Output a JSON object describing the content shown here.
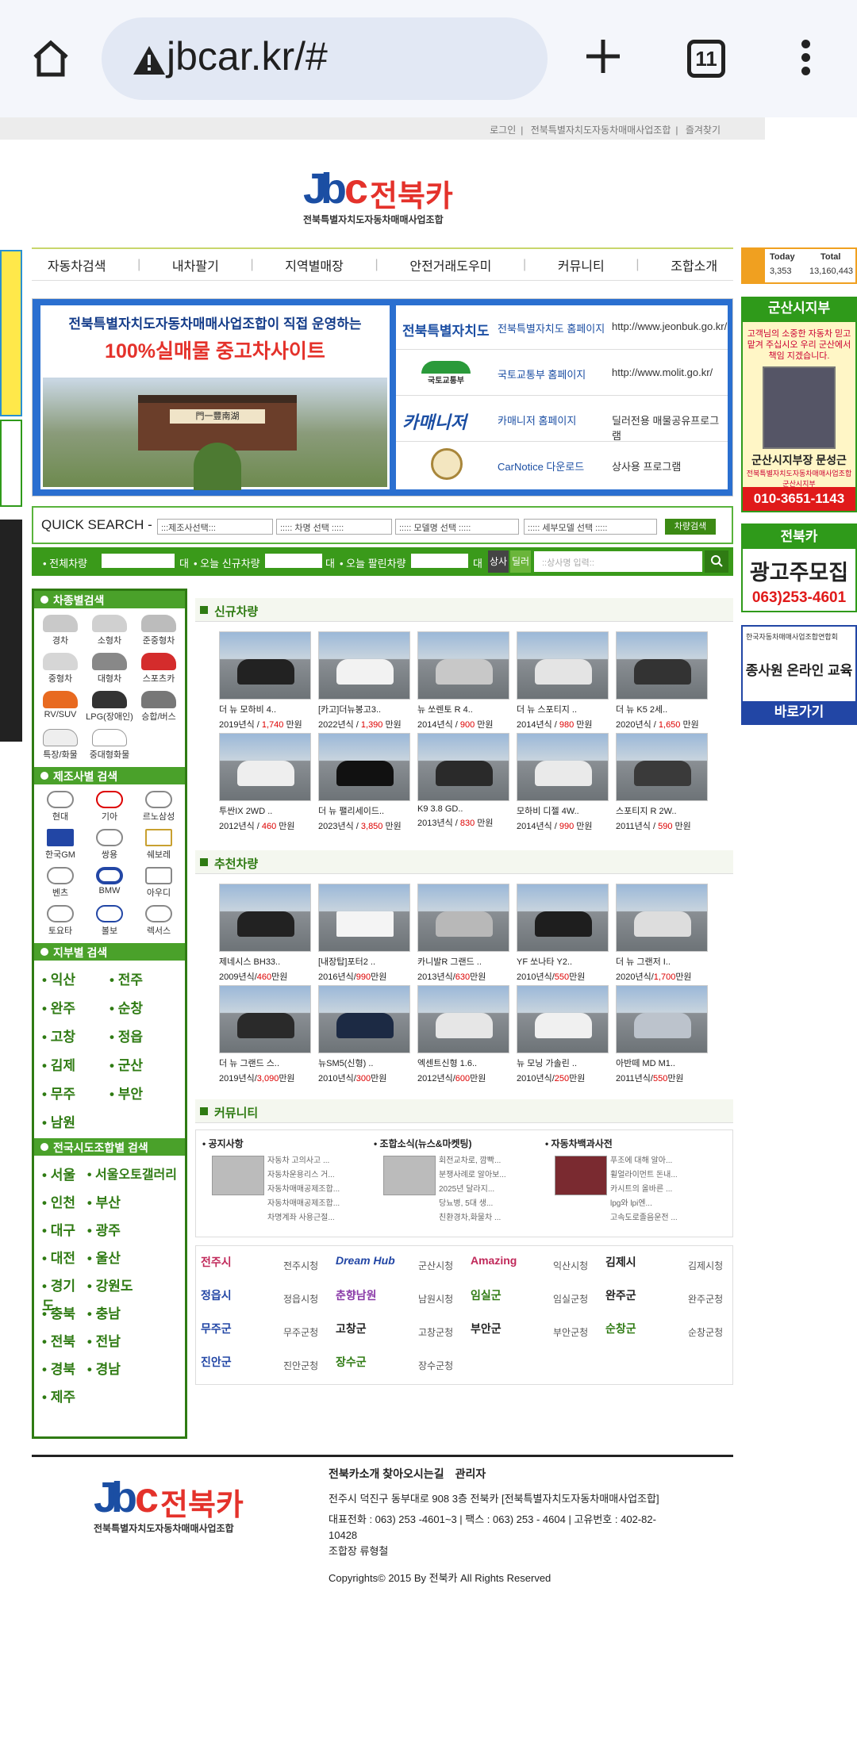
{
  "browser": {
    "url": "jbcar.kr/#",
    "tab_count": "11"
  },
  "topbar": {
    "links": [
      "로그인",
      "전북특별자치도자동차매매사업조합",
      "즐겨찾기"
    ]
  },
  "logo": {
    "brand": "전북카",
    "sub": "전북특별자치도자동차매매사업조합"
  },
  "nav": [
    "자동차검색",
    "내차팔기",
    "지역별매장",
    "안전거래도우미",
    "커뮤니티",
    "조합소개"
  ],
  "banner": {
    "line1": "전북특별자치도자동차매매사업조합이 직접 운영하는",
    "line2": "100%실매물 중고차사이트",
    "links": [
      {
        "logo": "전북특별자치도",
        "name": "전북특별자치도 홈페이지",
        "desc": "http://www.jeonbuk.go.kr/"
      },
      {
        "logo": "국토교통부",
        "name": "국토교통부 홈페이지",
        "desc": "http://www.molit.go.kr/"
      },
      {
        "logo": "카매니저",
        "name": "카매니저 홈페이지",
        "desc": "딜러전용 매물공유프로그램"
      },
      {
        "logo": "",
        "name": "CarNotice 다운로드",
        "desc": "상사용 프로그램"
      }
    ]
  },
  "quick_search": {
    "label": "QUICK SEARCH -",
    "selects": [
      ":::제조사선택:::",
      "::::: 차명 선택 :::::",
      "::::: 모델명 선택 :::::",
      "::::: 세부모델 선택 :::::"
    ],
    "button": "차량검색"
  },
  "stats": {
    "total": "• 전체차량",
    "unit": "대",
    "new_today": "• 오늘 신규차량",
    "sold_today": "• 오늘 팔린차량",
    "tab1": "상사",
    "tab2": "딜러",
    "placeholder": "::상사명 입력::"
  },
  "counter": {
    "today_label": "Today",
    "today": "3,353",
    "total_label": "Total",
    "total": "13,160,443"
  },
  "gunsan": {
    "title": "군산시지부",
    "msg": "고객님의 소중한 자동차 믿고 맡겨 주십시오 우리 군산에서 책임 지겠습니다.",
    "name": "군산시지부장 문성근",
    "org": "전북특별자치도자동차매매사업조합 군산시지부",
    "phone": "010-3651-1143"
  },
  "advert": {
    "title": "전북카",
    "text": "광고주모집",
    "phone": "063)253-4601"
  },
  "education": {
    "small": "한국자동차매매사업조합연합회",
    "text": "종사원 온라인 교육",
    "button": "바로가기"
  },
  "sidebar": {
    "type_title": "차종별검색",
    "types": [
      "경차",
      "소형차",
      "준중형차",
      "중형차",
      "대형차",
      "스포츠카",
      "RV/SUV",
      "LPG(장애인)",
      "승합/버스",
      "특장/화물",
      "중대형화물"
    ],
    "mfg_title": "제조사별 검색",
    "makers": [
      "현대",
      "기아",
      "르노삼성",
      "한국GM",
      "쌍용",
      "쉐보레",
      "벤츠",
      "BMW",
      "아우디",
      "토요타",
      "볼보",
      "렉서스"
    ],
    "branch_title": "지부별 검색",
    "branches": [
      "익산",
      "전주",
      "완주",
      "순창",
      "고창",
      "정읍",
      "김제",
      "군산",
      "무주",
      "부안",
      "남원"
    ],
    "region_title": "전국시도조합별 검색",
    "regions": [
      "서울",
      "서울오토갤러리",
      "인천",
      "부산",
      "대구",
      "광주",
      "대전",
      "울산",
      "경기도",
      "강원도",
      "충북",
      "충남",
      "전북",
      "전남",
      "경북",
      "경남",
      "제주"
    ]
  },
  "new_cars": {
    "title": "신규차량",
    "cars": [
      {
        "name": "더 뉴 모하비 4..",
        "year": "2019년식 / ",
        "price": "1,740",
        "unit": " 만원"
      },
      {
        "name": "[카고]더뉴봉고3..",
        "year": "2022년식 / ",
        "price": "1,390",
        "unit": " 만원"
      },
      {
        "name": "뉴 쏘렌토 R 4..",
        "year": "2014년식 / ",
        "price": "900",
        "unit": " 만원"
      },
      {
        "name": "더 뉴 스포티지 ..",
        "year": "2014년식 / ",
        "price": "980",
        "unit": " 만원"
      },
      {
        "name": "더 뉴 K5 2세..",
        "year": "2020년식 / ",
        "price": "1,650",
        "unit": " 만원"
      },
      {
        "name": "투싼IX 2WD ..",
        "year": "2012년식 / ",
        "price": "460",
        "unit": " 만원"
      },
      {
        "name": "더 뉴 팰리세이드..",
        "year": "2023년식 / ",
        "price": "3,850",
        "unit": " 만원"
      },
      {
        "name": "K9 3.8 GD..",
        "year": "2013년식 / ",
        "price": "830",
        "unit": " 만원"
      },
      {
        "name": "모하비 디젤 4W..",
        "year": "2014년식 / ",
        "price": "990",
        "unit": " 만원"
      },
      {
        "name": "스포티지 R 2W..",
        "year": "2011년식 / ",
        "price": "590",
        "unit": " 만원"
      }
    ]
  },
  "rec_cars": {
    "title": "추천차량",
    "cars": [
      {
        "name": "제네시스 BH33..",
        "year": "2009년식/",
        "price": "460",
        "unit": "만원"
      },
      {
        "name": "[내장탑]포터2 ..",
        "year": "2016년식/",
        "price": "990",
        "unit": "만원"
      },
      {
        "name": "카니발R 그랜드 ..",
        "year": "2013년식/",
        "price": "630",
        "unit": "만원"
      },
      {
        "name": "YF 쏘나타 Y2..",
        "year": "2010년식/",
        "price": "550",
        "unit": "만원"
      },
      {
        "name": "더 뉴 그랜저 I..",
        "year": "2020년식/",
        "price": "1,700",
        "unit": "만원"
      },
      {
        "name": "더 뉴 그랜드 스..",
        "year": "2019년식/",
        "price": "3,090",
        "unit": "만원"
      },
      {
        "name": "뉴SM5(신형) ..",
        "year": "2010년식/",
        "price": "300",
        "unit": "만원"
      },
      {
        "name": "엑센트신형 1.6..",
        "year": "2012년식/",
        "price": "600",
        "unit": "만원"
      },
      {
        "name": "뉴 모닝 가솔린 ..",
        "year": "2010년식/",
        "price": "250",
        "unit": "만원"
      },
      {
        "name": "아반떼 MD M1..",
        "year": "2011년식/",
        "price": "550",
        "unit": "만원"
      }
    ]
  },
  "community": {
    "title": "커뮤니티",
    "boxes": [
      {
        "title": "• 공지사항",
        "items": [
          "자동차 고의사고 ...",
          "자동차운용리스 거...",
          "자동차매매공제조합...",
          "자동차매매공제조합...",
          "차명계좌 사용근절..."
        ]
      },
      {
        "title": "• 조합소식(뉴스&마켓팅)",
        "items": [
          "회전교차로, 깜빡...",
          "분쟁사례로 알아보...",
          "2025년 달라지...",
          "당뇨병, 5대 생...",
          "친환경차,화물차 ..."
        ]
      },
      {
        "title": "• 자동차백과사전",
        "items": [
          "푸조에 대해 알아...",
          "휠얼라이먼트 돈내...",
          "카시트의 올바른 ...",
          "lpg와 lpi엔...",
          "고속도로졸음운전 ..."
        ]
      }
    ]
  },
  "cities": [
    {
      "logo": "전주시",
      "name": "전주시청"
    },
    {
      "logo": "Dream Hub",
      "name": "군산시청"
    },
    {
      "logo": "Amazing",
      "name": "익산시청"
    },
    {
      "logo": "김제시",
      "name": "김제시청"
    },
    {
      "logo": "정읍시",
      "name": "정읍시청"
    },
    {
      "logo": "춘향남원",
      "name": "남원시청"
    },
    {
      "logo": "임실군",
      "name": "임실군청"
    },
    {
      "logo": "완주군",
      "name": "완주군청"
    },
    {
      "logo": "무주군",
      "name": "무주군청"
    },
    {
      "logo": "고창군",
      "name": "고창군청"
    },
    {
      "logo": "부안군",
      "name": "부안군청"
    },
    {
      "logo": "순창군",
      "name": "순창군청"
    },
    {
      "logo": "진안군",
      "name": "진안군청"
    },
    {
      "logo": "장수군",
      "name": "장수군청"
    }
  ],
  "footer": {
    "link1": "전북카소개 찾아오시는길",
    "link2": "관리자",
    "addr": "전주시 덕진구 동부대로 908 3층 전북카 [전북특별자치도자동차매매사업조합]",
    "phone": "대표전화 : 063) 253 -4601~3 | 팩스 : 063) 253 - 4604 | 고유번호 : 402-82-10428",
    "chair": "조합장 류형철",
    "copy": "Copyrights© 2015 By 전북카 All Rights Reserved"
  }
}
